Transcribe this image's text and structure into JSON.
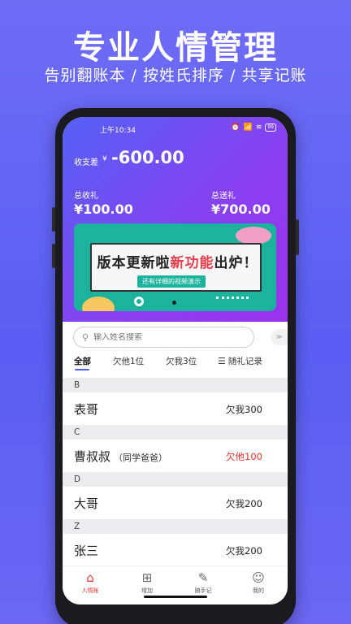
{
  "promo": {
    "title": "专业人情管理",
    "subtitle": "告别翻账本 / 按姓氏排序 / 共享记账"
  },
  "status_bar": {
    "time": "上午10:34",
    "battery": "99"
  },
  "summary": {
    "balance_label": "收支差",
    "balance_currency": "¥",
    "balance_value": "-600.00",
    "received_label": "总收礼",
    "received_value": "¥100.00",
    "sent_label": "总送礼",
    "sent_value": "¥700.00"
  },
  "banner": {
    "headline_part1": "版本更新啦",
    "headline_highlight": "新功能",
    "headline_part2": "出炉！",
    "subtext": "还有详细的视频演示"
  },
  "search": {
    "placeholder": "输入姓名搜索"
  },
  "tabs": {
    "all": "全部",
    "owe_them": "欠他1位",
    "owe_me": "欠我3位",
    "gift_record": "随礼记录"
  },
  "groups": [
    {
      "letter": "B",
      "name": "表哥",
      "note": "",
      "amount": "欠我300",
      "color": "#222222"
    },
    {
      "letter": "C",
      "name": "曹叔叔",
      "note": "（同学爸爸）",
      "amount": "欠他100",
      "color": "#e8312d"
    },
    {
      "letter": "D",
      "name": "大哥",
      "note": "",
      "amount": "欠我200",
      "color": "#222222"
    },
    {
      "letter": "Z",
      "name": "张三",
      "note": "",
      "amount": "欠我200",
      "color": "#222222"
    }
  ],
  "bottom_nav": {
    "home": "人情账",
    "add": "增加",
    "notes": "随手记",
    "mine": "我的"
  },
  "colors": {
    "accent": "#5561f4",
    "owe_them": "#e8312d",
    "nav_active": "#e8312d",
    "banner_bg": "#1bb39b"
  }
}
